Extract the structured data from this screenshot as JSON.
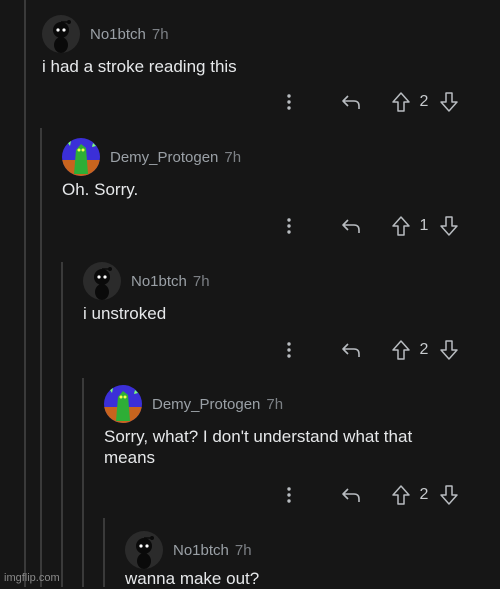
{
  "comments": [
    {
      "username": "No1btch",
      "time": "7h",
      "text": "i had a stroke reading this",
      "votes": "2",
      "avatar": "snoo-dark-avatar"
    },
    {
      "username": "Demy_Protogen",
      "time": "7h",
      "text": "Oh. Sorry.",
      "votes": "1",
      "avatar": "green-dragon-avatar"
    },
    {
      "username": "No1btch",
      "time": "7h",
      "text": "i unstroked",
      "votes": "2",
      "avatar": "snoo-dark-avatar"
    },
    {
      "username": "Demy_Protogen",
      "time": "7h",
      "text": "Sorry, what? I don't understand what that\nmeans",
      "votes": "2",
      "avatar": "green-dragon-avatar"
    },
    {
      "username": "No1btch",
      "time": "7h",
      "text": "wanna make out?",
      "avatar": "snoo-dark-avatar"
    }
  ],
  "icons": {
    "more": "more-vertical-icon",
    "reply": "reply-icon",
    "upvote": "upvote-arrow-icon",
    "downvote": "downvote-arrow-icon"
  },
  "watermark": "imgflip.com",
  "colors": {
    "background": "#161616",
    "thread_line": "#3a3a3a",
    "username": "#9aa0a6",
    "text": "#e6e8ea"
  }
}
